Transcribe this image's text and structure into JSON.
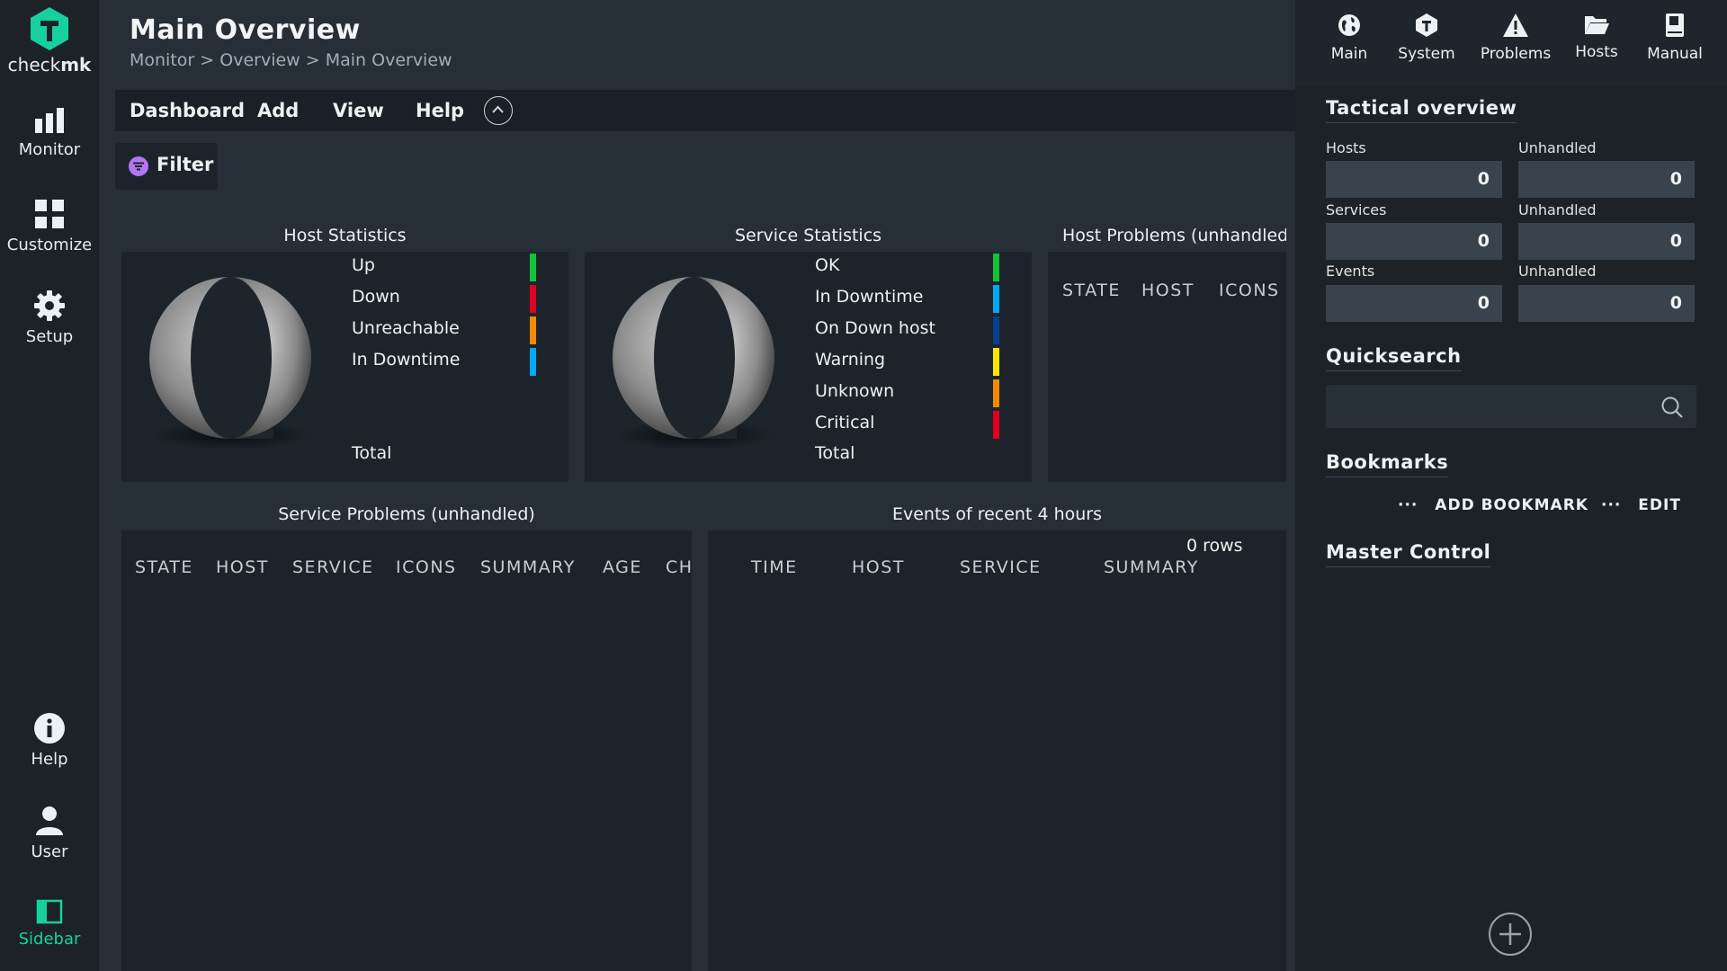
{
  "nav": {
    "logo_prefix": "check",
    "logo_suffix": "mk",
    "items": [
      {
        "label": "Monitor",
        "icon": "bar-chart-icon"
      },
      {
        "label": "Customize",
        "icon": "grid-icon"
      },
      {
        "label": "Setup",
        "icon": "gear-icon"
      },
      {
        "label": "Help",
        "icon": "info-icon"
      },
      {
        "label": "User",
        "icon": "user-icon"
      },
      {
        "label": "Sidebar",
        "icon": "sidebar-icon"
      }
    ],
    "accent": "#15d1a0"
  },
  "page": {
    "title": "Main Overview",
    "breadcrumb": [
      "Monitor",
      "Overview",
      "Main Overview"
    ],
    "breadcrumb_sep": ">"
  },
  "menubar": {
    "items": [
      "Dashboard",
      "Add",
      "View",
      "Help"
    ]
  },
  "filter": {
    "label": "Filter"
  },
  "host_stats": {
    "title": "Host Statistics",
    "legend": [
      {
        "label": "Up",
        "color": "#13c237"
      },
      {
        "label": "Down",
        "color": "#e0001f"
      },
      {
        "label": "Unreachable",
        "color": "#f28a06"
      },
      {
        "label": "In Downtime",
        "color": "#00aaf0"
      }
    ],
    "total_label": "Total"
  },
  "service_stats": {
    "title": "Service Statistics",
    "legend": [
      {
        "label": "OK",
        "color": "#13c237"
      },
      {
        "label": "In Downtime",
        "color": "#00aaf0"
      },
      {
        "label": "On Down host",
        "color": "#0a3f8c"
      },
      {
        "label": "Warning",
        "color": "#ffe600"
      },
      {
        "label": "Unknown",
        "color": "#f28a06"
      },
      {
        "label": "Critical",
        "color": "#e0001f"
      }
    ],
    "total_label": "Total"
  },
  "host_problems": {
    "title": "Host Problems (unhandled)",
    "columns": [
      "STATE",
      "HOST",
      "ICONS"
    ]
  },
  "service_problems": {
    "title": "Service Problems (unhandled)",
    "columns": [
      "STATE",
      "HOST",
      "SERVICE",
      "ICONS",
      "SUMMARY",
      "AGE",
      "CH"
    ]
  },
  "events": {
    "title": "Events of recent 4 hours",
    "rows_text": "0 rows",
    "columns": [
      "TIME",
      "HOST",
      "SERVICE",
      "SUMMARY"
    ]
  },
  "sidebar": {
    "tabs": [
      {
        "label": "Main",
        "icon": "globe-icon"
      },
      {
        "label": "System",
        "icon": "hexagon-icon"
      },
      {
        "label": "Problems",
        "icon": "warning-icon"
      },
      {
        "label": "Hosts",
        "icon": "folder-icon"
      },
      {
        "label": "Manual",
        "icon": "book-icon"
      }
    ],
    "tactical": {
      "title": "Tactical overview",
      "rows": [
        {
          "label": "Hosts",
          "value": "0",
          "unhandled_label": "Unhandled",
          "unhandled_value": "0"
        },
        {
          "label": "Services",
          "value": "0",
          "unhandled_label": "Unhandled",
          "unhandled_value": "0"
        },
        {
          "label": "Events",
          "value": "0",
          "unhandled_label": "Unhandled",
          "unhandled_value": "0"
        }
      ]
    },
    "quicksearch": {
      "title": "Quicksearch",
      "placeholder": ""
    },
    "bookmarks": {
      "title": "Bookmarks",
      "add_label": "ADD BOOKMARK",
      "edit_label": "EDIT",
      "dots": "···"
    },
    "master_control": {
      "title": "Master Control"
    }
  }
}
